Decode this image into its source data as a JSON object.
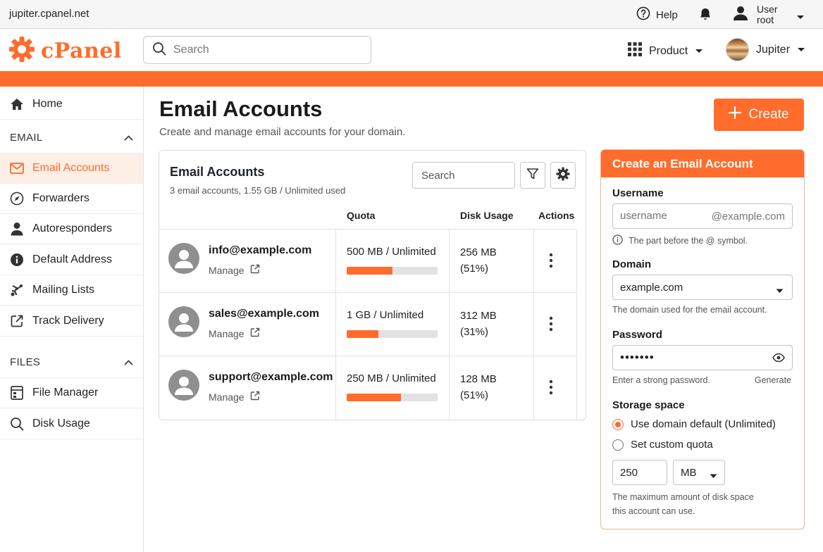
{
  "topbar": {
    "host": "jupiter.cpanel.net",
    "help_label": "Help",
    "user_line1": "User",
    "user_line2": "root"
  },
  "header": {
    "logo_text": "cPanel",
    "search_placeholder": "Search",
    "product_label": "Product",
    "theme_label": "Jupiter"
  },
  "sidebar": {
    "home": "Home",
    "email_section": "EMAIL",
    "email_items": [
      {
        "label": "Email Accounts",
        "icon": "envelope-icon"
      },
      {
        "label": "Forwarders",
        "icon": "compass-icon"
      },
      {
        "label": "Autoresponders",
        "icon": "person-icon"
      },
      {
        "label": "Default Address",
        "icon": "info-icon"
      },
      {
        "label": "Mailing Lists",
        "icon": "broadcast-icon"
      },
      {
        "label": "Track Delivery",
        "icon": "external-arrow-icon"
      }
    ],
    "files_section": "FILES",
    "files_items": [
      {
        "label": "File Manager",
        "icon": "file-manager-icon"
      },
      {
        "label": "Disk Usage",
        "icon": "magnifier-icon"
      }
    ]
  },
  "main": {
    "title": "Email Accounts",
    "subtitle": "Create and manage email accounts for your domain.",
    "create_label": "Create"
  },
  "accounts": {
    "title": "Email Accounts",
    "summary": "3 email accounts, 1.55 GB / Unlimited used",
    "search_placeholder": "Search",
    "columns": {
      "quota": "Quota",
      "disk": "Disk Usage",
      "actions": "Actions"
    },
    "manage_label": "Manage",
    "rows": [
      {
        "email": "info@example.com",
        "quota": "500 MB / Unlimited",
        "usage_fraction": 0.5,
        "disk_line1": "256 MB",
        "disk_line2": "(51%)"
      },
      {
        "email": "sales@example.com",
        "quota": "1 GB / Unlimited",
        "usage_fraction": 0.35,
        "disk_line1": "312 MB",
        "disk_line2": "(31%)"
      },
      {
        "email": "support@example.com",
        "quota": "250 MB / Unlimited",
        "usage_fraction": 0.6,
        "disk_line1": "128 MB",
        "disk_line2": "(51%)"
      }
    ]
  },
  "form": {
    "title": "Create an Email Account",
    "username_label": "Username",
    "username_placeholder": "username",
    "username_suffix": "@example.com",
    "username_hint": "The part before the @ symbol.",
    "domain_label": "Domain",
    "domain_value": "example.com",
    "domain_hint": "The domain used for the email account.",
    "password_label": "Password",
    "password_mask": "•••••••",
    "password_hint": "Enter a strong password.",
    "generate_label": "Generate",
    "storage_label": "Storage space",
    "option_default": "Use domain default (Unlimited)",
    "option_custom": "Set custom quota",
    "quota_value": "250",
    "quota_unit": "MB",
    "quota_hint_line1": "The maximum amount of disk space",
    "quota_hint_line2": "this account can use."
  },
  "colors": {
    "accent": "#ff6c2c",
    "active_bg": "#fdeee6"
  }
}
